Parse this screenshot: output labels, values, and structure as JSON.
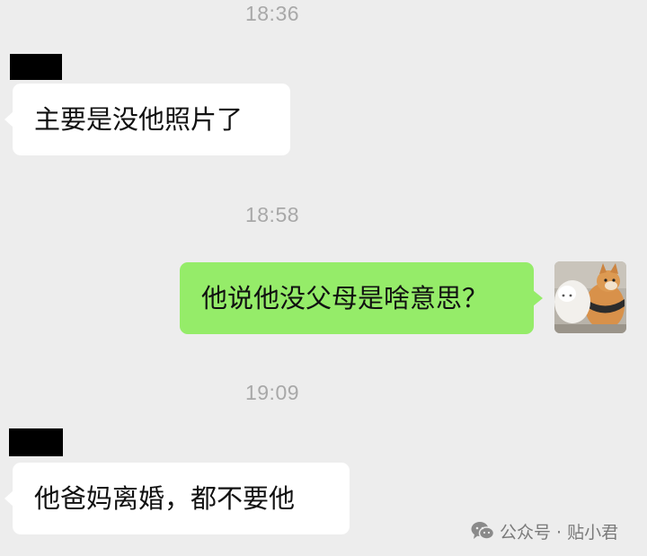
{
  "chat": {
    "messages": [
      {
        "type": "timestamp",
        "text": "18:36"
      },
      {
        "type": "received",
        "text": "主要是没他照片了"
      },
      {
        "type": "timestamp",
        "text": "18:58"
      },
      {
        "type": "sent",
        "text": "他说他没父母是啥意思？"
      },
      {
        "type": "timestamp",
        "text": "19:09"
      },
      {
        "type": "received",
        "text": "他爸妈离婚，都不要他"
      }
    ]
  },
  "colors": {
    "background": "#ededed",
    "sent_bubble": "#95ec69",
    "received_bubble": "#ffffff",
    "timestamp_text": "#a8a8a8"
  },
  "avatar": {
    "icon": "shiba-dog-avatar-icon"
  },
  "watermark": {
    "icon": "wechat-official-account-icon",
    "text": "公众号 · 贴小君"
  }
}
